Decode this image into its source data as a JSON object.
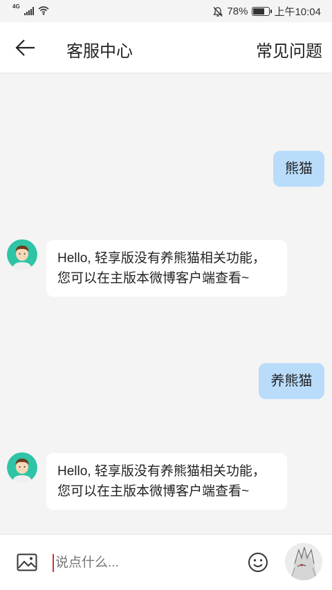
{
  "status_bar": {
    "network": "4G",
    "battery": "78%",
    "battery_level": 0.78,
    "time": "上午10:04"
  },
  "header": {
    "back_icon": "arrow-left-icon",
    "title": "客服中心",
    "faq_label": "常见问题"
  },
  "messages": [
    {
      "from": "user",
      "text": "熊猫"
    },
    {
      "from": "agent",
      "text": "Hello, 轻享版没有养熊猫相关功能，您可以在主版本微博客户端查看~"
    },
    {
      "from": "user",
      "text": "养熊猫"
    },
    {
      "from": "agent",
      "text": "Hello, 轻享版没有养熊猫相关功能，您可以在主版本微博客户端查看~"
    }
  ],
  "input_bar": {
    "image_icon": "image-icon",
    "placeholder": "说点什么...",
    "emoji_icon": "emoji-icon"
  },
  "colors": {
    "user_bubble": "#b9dcfa",
    "agent_bubble": "#ffffff",
    "background": "#f4f4f4",
    "avatar_teal": "#2ec4a5"
  }
}
